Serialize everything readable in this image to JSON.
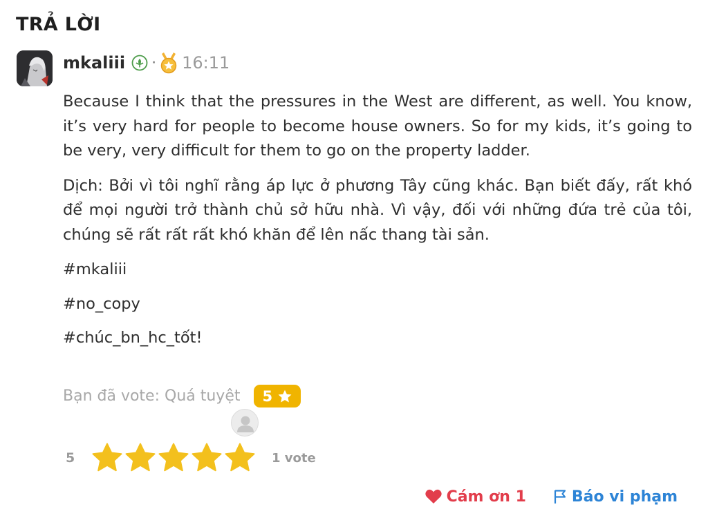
{
  "section": {
    "title": "TRẢ LỜI"
  },
  "answer": {
    "author": "mkaliii",
    "separator": "·",
    "time": "16:11",
    "icons": {
      "verified": "leaf-badge-icon",
      "medal": "medal-icon"
    },
    "paragraphs": [
      "Because I think that the pressures in the West are different, as well. You know, it’s very hard for people to become house owners. So for my kids, it’s going to be very, very difficult for them to go on the property ladder.",
      "Dịch: Bởi vì tôi nghĩ rằng áp lực ở phương Tây cũng khác. Bạn biết đấy, rất khó để mọi người trở thành chủ sở hữu nhà. Vì vậy, đối với những đứa trẻ của tôi, chúng sẽ rất rất rất khó khăn để lên nấc thang tài sản."
    ],
    "tags": [
      "#mkaliii",
      "#no_copy",
      "#chúc_bn_hc_tốt!"
    ]
  },
  "vote": {
    "label": "Bạn đã vote: Quá tuyệt",
    "badge_value": "5",
    "rating_value": "5",
    "stars_filled": 5,
    "stars_total": 5,
    "count_text": "1 vote"
  },
  "actions": {
    "thanks_label": "Cám ơn 1",
    "report_label": "Báo vi phạm"
  },
  "colors": {
    "star": "#f3c01d",
    "badge": "#f0b400",
    "thanks": "#e23d4b",
    "report": "#2d84d6"
  }
}
